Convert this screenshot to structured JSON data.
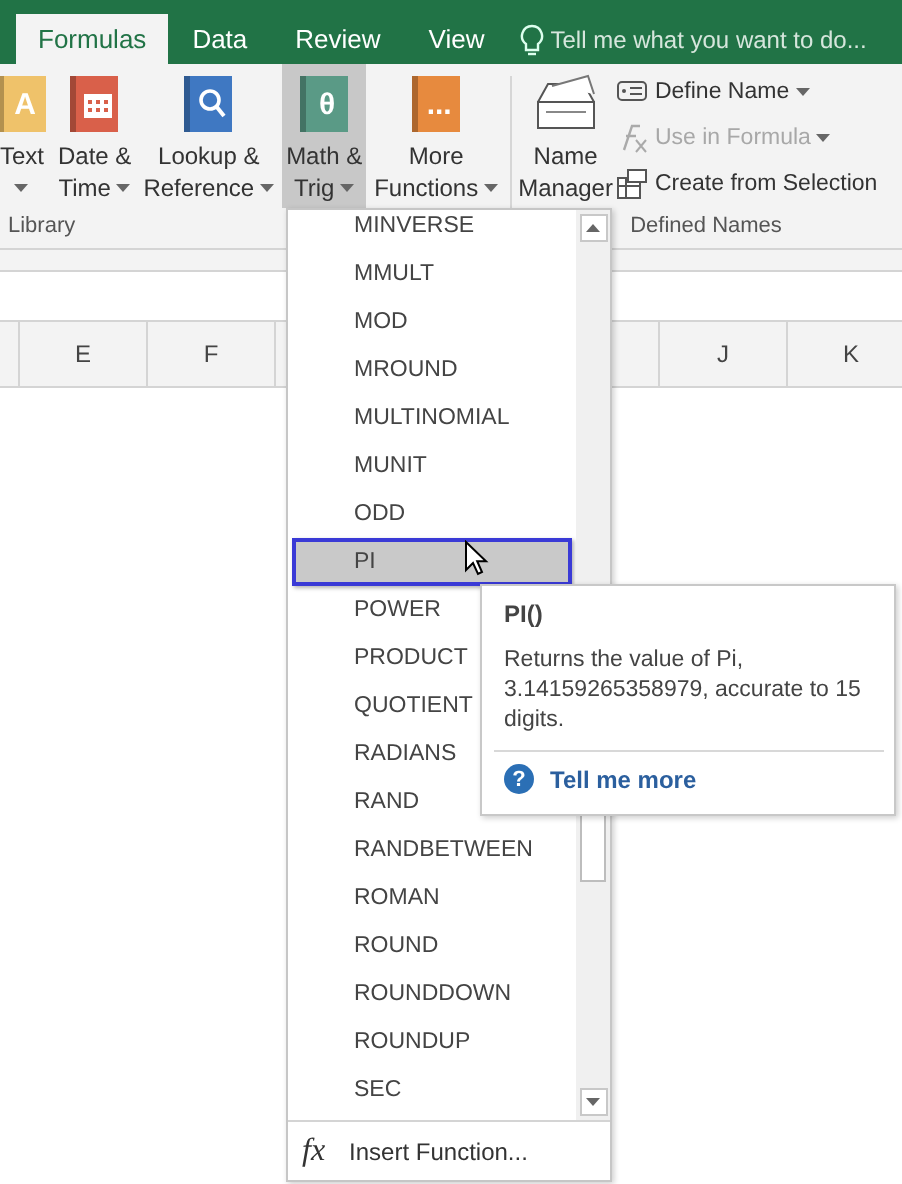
{
  "ribbon_tabs": [
    {
      "label": "Formulas",
      "selected": true
    },
    {
      "label": "Data",
      "selected": false
    },
    {
      "label": "Review",
      "selected": false
    },
    {
      "label": "View",
      "selected": false
    }
  ],
  "tell_me": {
    "placeholder": "Tell me what you want to do..."
  },
  "groups": [
    {
      "label": "Library",
      "kind": "large",
      "buttons": [
        {
          "kind": "text",
          "glyph": "A",
          "lines": [
            "Text"
          ],
          "has_menu": true,
          "selected": false
        },
        {
          "kind": "date",
          "lines": [
            "Date &",
            "Time"
          ],
          "has_menu": true,
          "selected": false
        },
        {
          "kind": "lookup",
          "lines": [
            "Lookup &",
            "Reference"
          ],
          "has_menu": true,
          "selected": false
        },
        {
          "kind": "math",
          "glyph": "θ",
          "lines": [
            "Math &",
            "Trig"
          ],
          "has_menu": true,
          "selected": true
        },
        {
          "kind": "more",
          "glyph": "...",
          "lines": [
            "More",
            "Functions"
          ],
          "has_menu": true,
          "selected": false
        }
      ]
    },
    {
      "label": "Defined Names",
      "kind": "names",
      "buttons": [
        {
          "kind": "manager",
          "lines": [
            "Name",
            "Manager"
          ],
          "has_menu": false,
          "selected": false
        }
      ],
      "small_buttons": [
        {
          "kind": "define",
          "label": "Define Name",
          "has_menu": true,
          "disabled": false
        },
        {
          "kind": "use",
          "label": "Use in Formula",
          "has_menu": true,
          "disabled": true
        },
        {
          "kind": "create",
          "label": "Create from Selection",
          "has_menu": false,
          "disabled": false
        }
      ]
    }
  ],
  "columns": [
    {
      "label": "E"
    },
    {
      "label": "F"
    },
    {
      "label": "J"
    },
    {
      "label": "K"
    }
  ],
  "function_menu": {
    "items": [
      {
        "label": "MINVERSE",
        "selected": false
      },
      {
        "label": "MMULT",
        "selected": false
      },
      {
        "label": "MOD",
        "selected": false
      },
      {
        "label": "MROUND",
        "selected": false
      },
      {
        "label": "MULTINOMIAL",
        "selected": false
      },
      {
        "label": "MUNIT",
        "selected": false
      },
      {
        "label": "ODD",
        "selected": false
      },
      {
        "label": "PI",
        "selected": true
      },
      {
        "label": "POWER",
        "selected": false
      },
      {
        "label": "PRODUCT",
        "selected": false
      },
      {
        "label": "QUOTIENT",
        "selected": false
      },
      {
        "label": "RADIANS",
        "selected": false
      },
      {
        "label": "RAND",
        "selected": false
      },
      {
        "label": "RANDBETWEEN",
        "selected": false
      },
      {
        "label": "ROMAN",
        "selected": false
      },
      {
        "label": "ROUND",
        "selected": false
      },
      {
        "label": "ROUNDDOWN",
        "selected": false
      },
      {
        "label": "ROUNDUP",
        "selected": false
      },
      {
        "label": "SEC",
        "selected": false
      }
    ],
    "footer": {
      "icon_glyph": "fx",
      "label": "Insert Function..."
    }
  },
  "tooltip": {
    "title": "PI()",
    "description": "Returns the value of Pi, 3.14159265358979, accurate to 15 digits.",
    "link": "Tell me more",
    "link_glyph": "?"
  }
}
